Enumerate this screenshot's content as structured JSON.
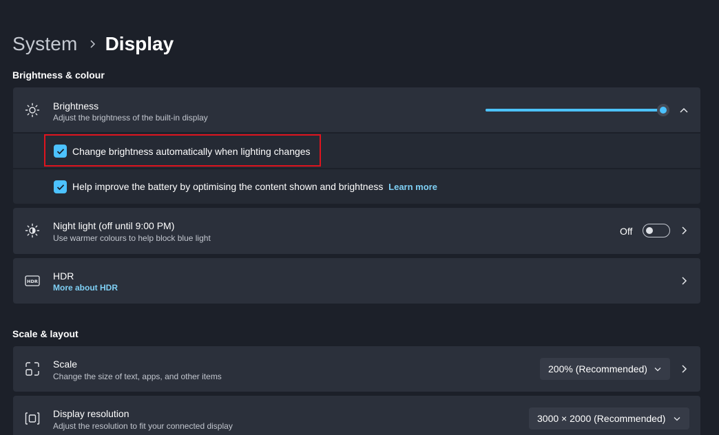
{
  "breadcrumb": {
    "parent": "System",
    "current": "Display"
  },
  "sections": {
    "brightness_colour": "Brightness & colour",
    "scale_layout": "Scale & layout"
  },
  "brightness": {
    "title": "Brightness",
    "description": "Adjust the brightness of the built-in display",
    "level_percent": 100,
    "auto_brightness": {
      "label": "Change brightness automatically when lighting changes",
      "checked": true
    },
    "battery_optimise": {
      "label": "Help improve the battery by optimising the content shown and brightness",
      "link": "Learn more",
      "checked": true
    }
  },
  "night_light": {
    "title": "Night light (off until 9:00 PM)",
    "description": "Use warmer colours to help block blue light",
    "toggle_label": "Off",
    "toggle_on": false
  },
  "hdr": {
    "title": "HDR",
    "link": "More about HDR"
  },
  "scale": {
    "title": "Scale",
    "description": "Change the size of text, apps, and other items",
    "selected": "200% (Recommended)"
  },
  "resolution": {
    "title": "Display resolution",
    "description": "Adjust the resolution to fit your connected display",
    "selected": "3000 × 2000 (Recommended)"
  },
  "colors": {
    "accent": "#4cc2ff",
    "link": "#7fd0f5",
    "highlight_box": "#e0141e",
    "card": "#2b303b",
    "background": "#1c2029"
  },
  "icons": {
    "brightness": "sun-icon",
    "night_light": "night-light-icon",
    "hdr": "hdr-icon",
    "scale": "scale-icon",
    "resolution": "resolution-icon"
  }
}
